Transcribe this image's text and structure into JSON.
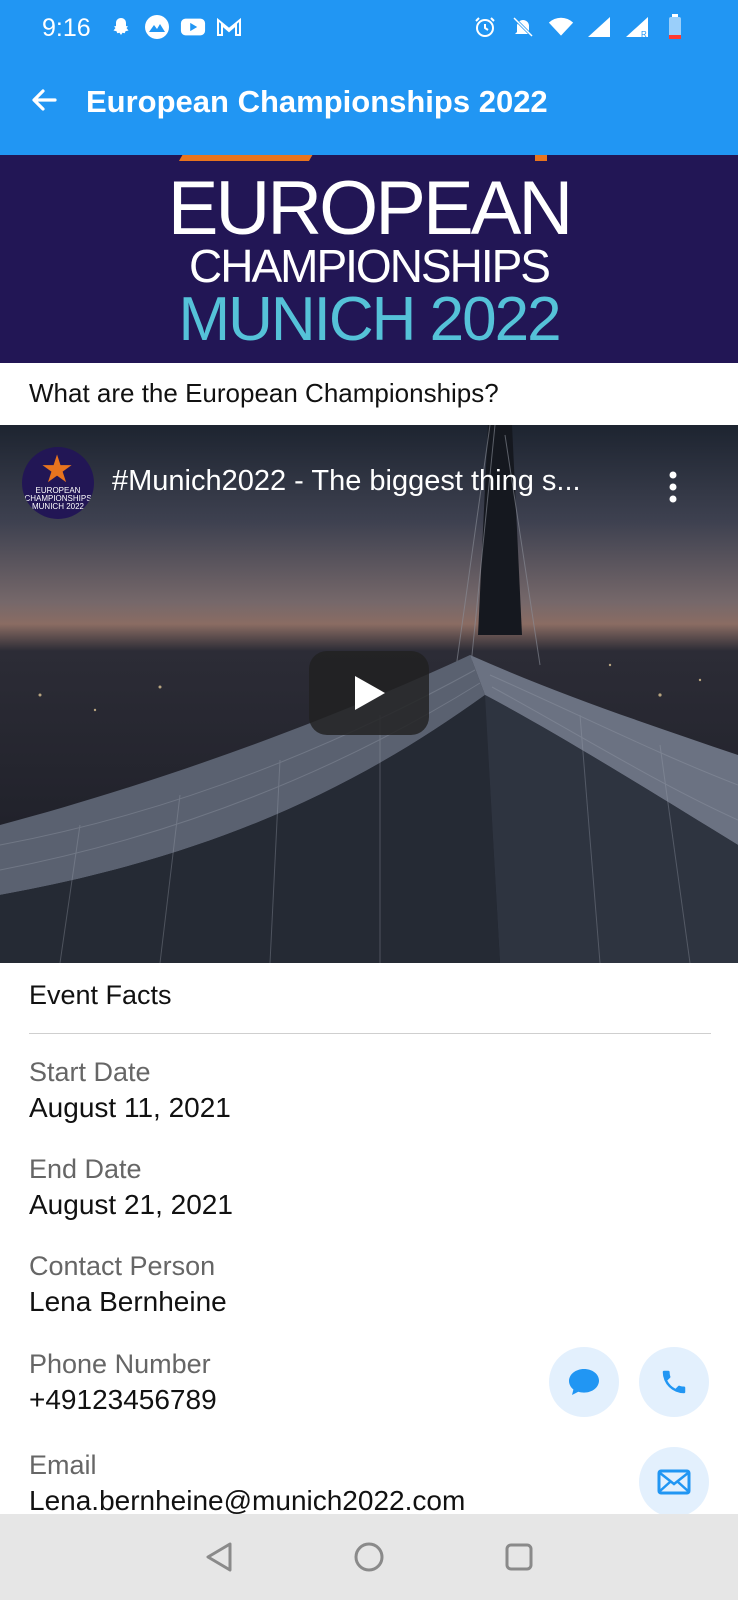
{
  "status_bar": {
    "time": "9:16",
    "left_icons": [
      "snapchat-icon",
      "mountain-app-icon",
      "youtube-icon",
      "gmail-icon"
    ],
    "right_icons": [
      "alarm-icon",
      "mute-icon",
      "wifi-icon",
      "signal-icon",
      "signal-roaming-icon",
      "battery-low-icon"
    ]
  },
  "app_bar": {
    "title": "European Championships 2022",
    "back_icon": "arrow-back-icon",
    "background_color": "#2196F3"
  },
  "banner": {
    "line1": "EUROPEAN",
    "line2": "CHAMPIONSHIPS",
    "line3": "MUNICH 2022",
    "background_color": "#221655",
    "accent_color": "#55c2d8"
  },
  "question": "What are the European Championships?",
  "video": {
    "title": "#Munich2022 - The biggest thing s...",
    "channel_avatar_text": "EUROPEAN CHAMPIONSHIPS MUNICH 2022",
    "menu_icon": "more-vert-icon",
    "play_icon": "play-icon"
  },
  "event_facts": {
    "title": "Event Facts",
    "items": [
      {
        "label": "Start Date",
        "value": "August 11, 2021"
      },
      {
        "label": "End Date",
        "value": "August 21, 2021"
      },
      {
        "label": "Contact Person",
        "value": "Lena Bernheine"
      },
      {
        "label": "Phone Number",
        "value": "+49123456789"
      },
      {
        "label": "Email",
        "value": "Lena.bernheine@munich2022.com"
      }
    ]
  },
  "actions": {
    "message_icon": "chat-bubble-icon",
    "call_icon": "phone-icon",
    "email_icon": "mail-icon",
    "accent_color": "#2196F3"
  },
  "nav_bar": {
    "back_icon": "nav-back-icon",
    "home_icon": "nav-home-icon",
    "recents_icon": "nav-recents-icon"
  }
}
